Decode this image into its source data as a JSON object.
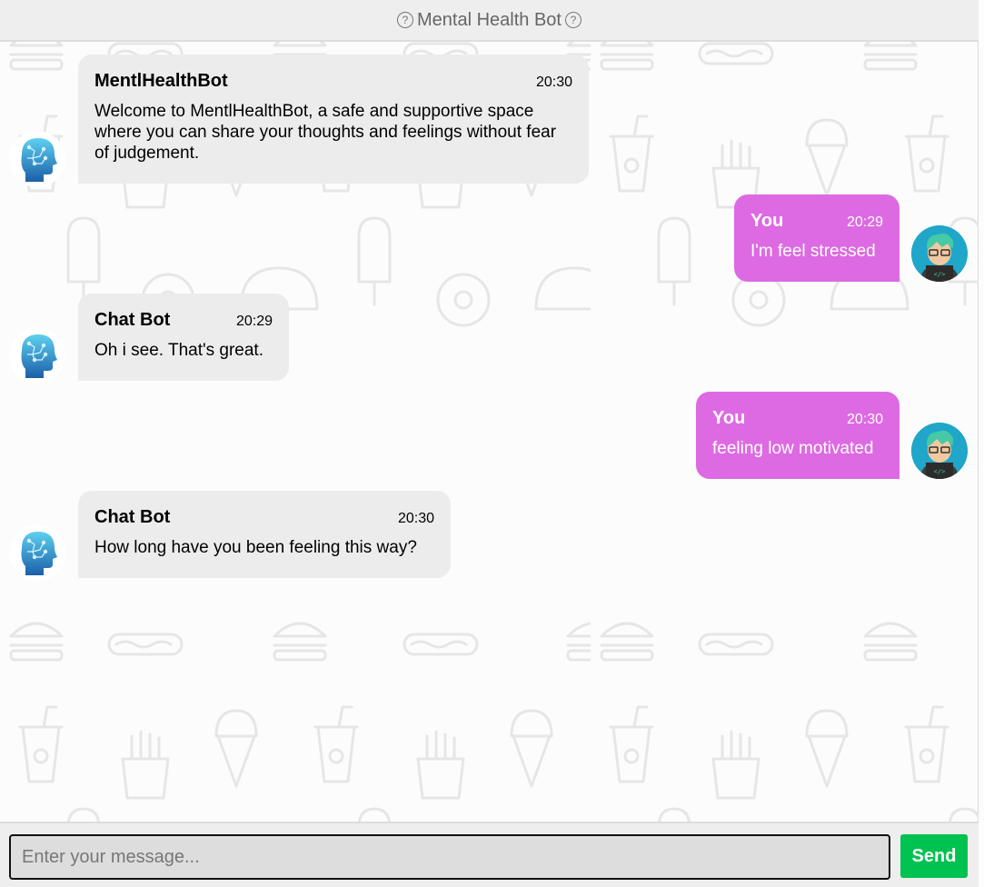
{
  "header": {
    "title": "Mental Health Bot",
    "help_glyph": "?"
  },
  "messages": [
    {
      "sender": "MentlHealthBot",
      "time": "20:30",
      "text": "Welcome to MentlHealthBot, a safe and supportive space where you can share your thoughts and feelings without fear of judgement.",
      "side": "left"
    },
    {
      "sender": "You",
      "time": "20:29",
      "text": "I'm feel stressed",
      "side": "right"
    },
    {
      "sender": "Chat Bot",
      "time": "20:29",
      "text": "Oh i see. That's great.",
      "side": "left"
    },
    {
      "sender": "You",
      "time": "20:30",
      "text": "feeling low motivated",
      "side": "right"
    },
    {
      "sender": "Chat Bot",
      "time": "20:30",
      "text": "How long have you been feeling this way?",
      "side": "left"
    }
  ],
  "composer": {
    "placeholder": "Enter your message...",
    "value": "",
    "send_label": "Send"
  },
  "colors": {
    "bot_bubble": "#ececec",
    "user_bubble": "#dd6ae2",
    "send_button": "#00c251",
    "header_bg": "#eeeeee"
  },
  "icons": {
    "bot_avatar": "brain-head-icon",
    "user_avatar": "coder-avatar-icon",
    "background": "food-pattern"
  }
}
